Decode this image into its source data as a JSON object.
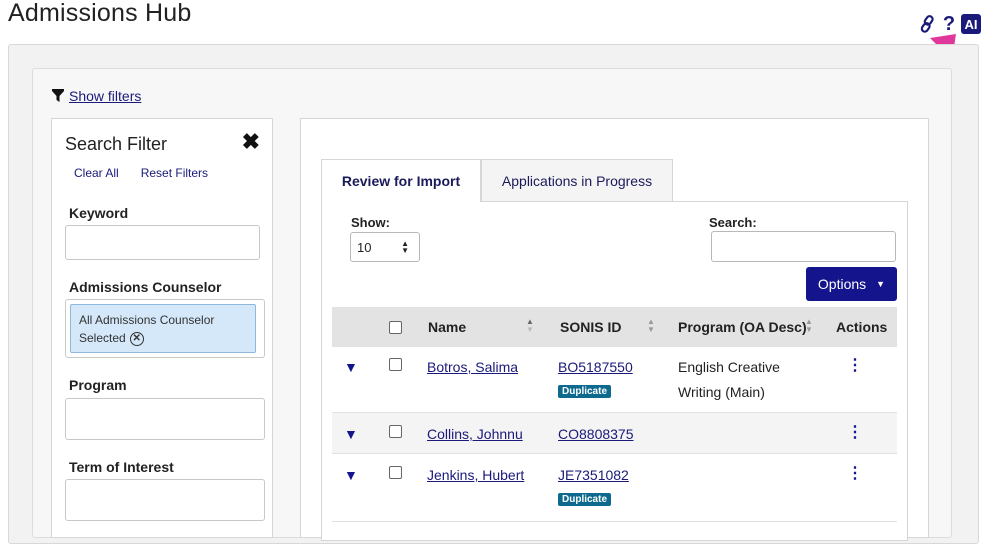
{
  "page": {
    "title": "Admissions Hub"
  },
  "top_icons": {
    "link": "link-icon",
    "help": "?",
    "ai": "AI"
  },
  "filters_toggle": {
    "label": "Show filters"
  },
  "search_filter": {
    "title": "Search Filter",
    "clear_all": "Clear All",
    "reset_filters": "Reset Filters",
    "keyword_label": "Keyword",
    "keyword_value": "",
    "counselor_label": "Admissions Counselor",
    "counselor_chip": "All Admissions Counselor Selected",
    "program_label": "Program",
    "program_value": "",
    "term_label": "Term of Interest",
    "term_value": ""
  },
  "tabs": [
    {
      "label": "Review for Import",
      "active": true
    },
    {
      "label": "Applications in Progress",
      "active": false
    }
  ],
  "table_controls": {
    "show_label": "Show:",
    "show_value": "10",
    "search_label": "Search:",
    "search_value": "",
    "options_label": "Options"
  },
  "table": {
    "columns": [
      "Name",
      "SONIS ID",
      "Program (OA Desc)",
      "Actions"
    ],
    "rows": [
      {
        "name": "Botros, Salima",
        "sonis_id": "BO5187550",
        "badge": "Duplicate",
        "program_line1": "English Creative",
        "program_line2": "Writing (Main)"
      },
      {
        "name": "Collins, Johnnu",
        "sonis_id": "CO8808375",
        "badge": "",
        "program_line1": "",
        "program_line2": ""
      },
      {
        "name": "Jenkins, Hubert",
        "sonis_id": "JE7351082",
        "badge": "Duplicate",
        "program_line1": "",
        "program_line2": ""
      }
    ]
  },
  "colors": {
    "brand_navy": "#14148c",
    "badge_teal": "#0d6a8e",
    "arrow_pink": "#e0379b"
  }
}
